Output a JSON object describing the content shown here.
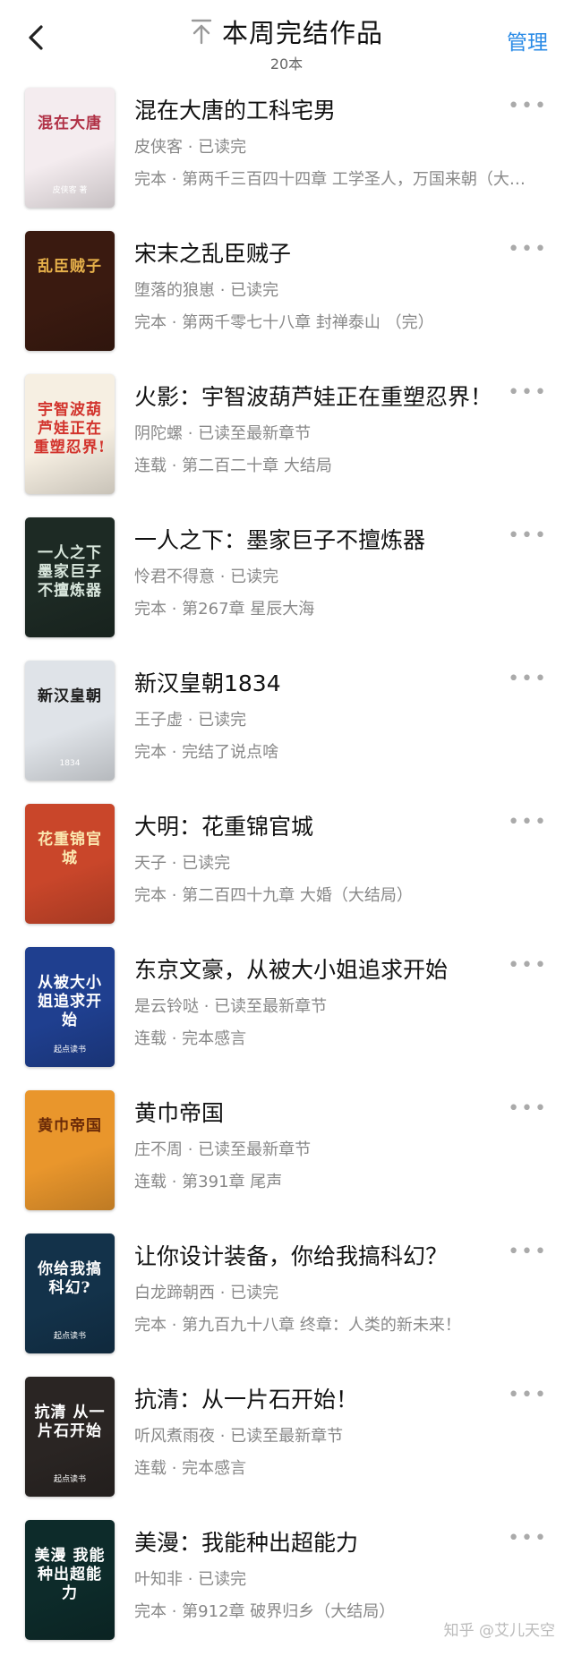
{
  "header": {
    "title": "本周完结作品",
    "count": "20本",
    "manage_label": "管理",
    "icons": {
      "back": "back-arrow-icon",
      "pin": "pin-top-icon"
    }
  },
  "books": [
    {
      "title": "混在大唐的工科宅男",
      "meta": "皮侠客 · 已读完",
      "status": "完本 · 第两千三百四十四章 工学圣人，万国来朝（大结局）",
      "cover": {
        "bg": "#f4ecef",
        "fg": "#b03045",
        "text": "混在大唐",
        "sub": "皮侠客 著"
      }
    },
    {
      "title": "宋末之乱臣贼子",
      "meta": "堕落的狼崽 · 已读完",
      "status": "完本 · 第两千零七十八章 封禅泰山 （完）",
      "cover": {
        "bg": "#3a1a10",
        "fg": "#e6b04a",
        "text": "乱臣贼子",
        "sub": ""
      }
    },
    {
      "title": "火影：宇智波葫芦娃正在重塑忍界！",
      "meta": "阴陀螺 · 已读至最新章节",
      "status": "连载 · 第二百二十章 大结局",
      "cover": {
        "bg": "#f6efe2",
        "fg": "#d2332c",
        "text": "宇智波葫芦娃正在重塑忍界!",
        "sub": ""
      }
    },
    {
      "title": "一人之下：墨家巨子不擅炼器",
      "meta": "怜君不得意 · 已读完",
      "status": "完本 · 第267章 星辰大海",
      "cover": {
        "bg": "#1d2a24",
        "fg": "#d8e6dc",
        "text": "一人之下 墨家巨子 不擅炼器",
        "sub": ""
      }
    },
    {
      "title": "新汉皇朝1834",
      "meta": "王子虚 · 已读完",
      "status": "完本 · 完结了说点啥",
      "cover": {
        "bg": "#dfe3e8",
        "fg": "#1c1c1c",
        "text": "新汉皇朝",
        "sub": "1834"
      }
    },
    {
      "title": "大明：花重锦官城",
      "meta": "天子 · 已读完",
      "status": "完本 · 第二百四十九章 大婚（大结局）",
      "cover": {
        "bg": "#c9462a",
        "fg": "#fbe8b0",
        "text": "花重锦官城",
        "sub": ""
      }
    },
    {
      "title": "东京文豪，从被大小姐追求开始",
      "meta": "是云铃哒 · 已读至最新章节",
      "status": "连载 · 完本感言",
      "cover": {
        "bg": "#1f3f8f",
        "fg": "#ffffff",
        "text": "从被大小姐追求开始",
        "sub": "起点读书"
      }
    },
    {
      "title": "黄巾帝国",
      "meta": "庄不周 · 已读至最新章节",
      "status": "连载 · 第391章 尾声",
      "cover": {
        "bg": "#e9962c",
        "fg": "#6a2a08",
        "text": "黄巾帝国",
        "sub": ""
      }
    },
    {
      "title": "让你设计装备，你给我搞科幻？",
      "meta": "白龙蹄朝西 · 已读完",
      "status": "完本 · 第九百九十八章 终章：人类的新未来！",
      "cover": {
        "bg": "#13324a",
        "fg": "#ffffff",
        "text": "你给我搞科幻?",
        "sub": "起点读书"
      }
    },
    {
      "title": "抗清：从一片石开始！",
      "meta": "听风煮雨夜 · 已读至最新章节",
      "status": "连载 · 完本感言",
      "cover": {
        "bg": "#2a2523",
        "fg": "#ffffff",
        "text": "抗清 从一片石开始",
        "sub": "起点读书"
      }
    },
    {
      "title": "美漫：我能种出超能力",
      "meta": "叶知非 · 已读完",
      "status": "完本 · 第912章 破界归乡（大结局）",
      "cover": {
        "bg": "#0d2b2a",
        "fg": "#ffffff",
        "text": "美漫 我能种出超能力",
        "sub": ""
      }
    }
  ],
  "more_label": "•••",
  "watermark": "知乎 @艾儿天空"
}
